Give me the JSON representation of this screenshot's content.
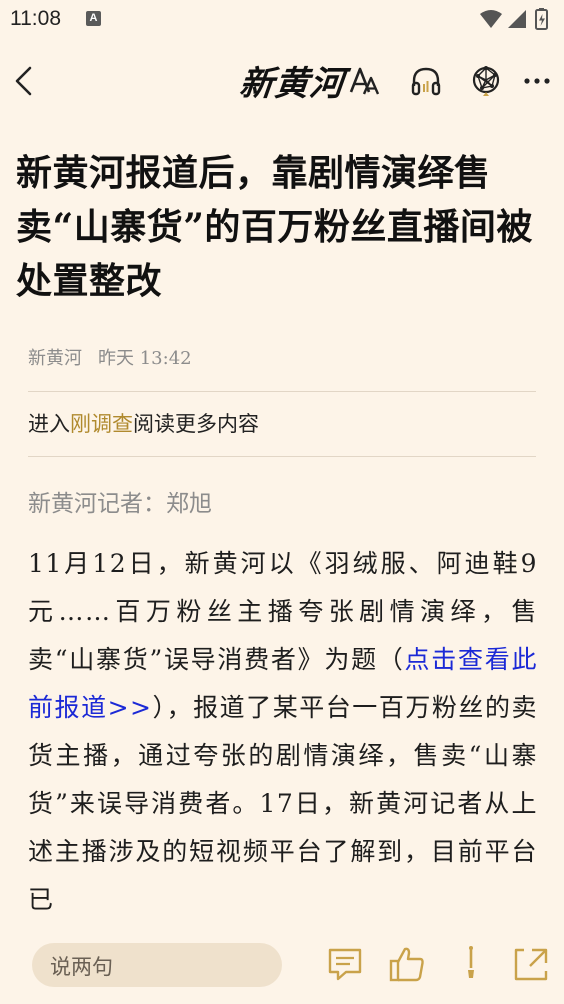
{
  "status_bar": {
    "time": "11:08",
    "notification_badge": "A"
  },
  "nav": {
    "logo": "新黄河",
    "icons": [
      "back-arrow-icon",
      "font-size-icon",
      "headphones-icon",
      "ai-network-icon",
      "more-dots-icon"
    ]
  },
  "article": {
    "headline": "新黄河报道后，靠剧情演绎售卖“山寨货”的百万粉丝直播间被处置整改",
    "source": "新黄河",
    "time": "昨天 13:42",
    "promo_prefix": "进入",
    "promo_link": "刚调查",
    "promo_suffix": "阅读更多内容",
    "byline": "新黄河记者：郑旭",
    "body_part1": "11月12日，新黄河以《羽绒服、阿迪鞋9元……百万粉丝主播夸张剧情演绎，售卖“山寨货”误导消费者》为题（",
    "body_link": "点击查看此前报道>>",
    "body_part2": "），报道了某平台一百万粉丝的卖货主播，通过夸张的剧情演绎，售卖“山寨货”来误导消费者。17日，新黄河记者从上述主播涉及的短视频平台了解到，目前平台已"
  },
  "bottom_bar": {
    "comment_placeholder": "说两句",
    "icons": [
      "comment-icon",
      "like-icon",
      "brush-icon",
      "share-icon"
    ]
  },
  "colors": {
    "background": "#fdf4e8",
    "promo_link": "#b08a2e",
    "article_link": "#1b29d6",
    "comment_box": "#efe1cc",
    "icon_gold": "#c9a24a"
  }
}
